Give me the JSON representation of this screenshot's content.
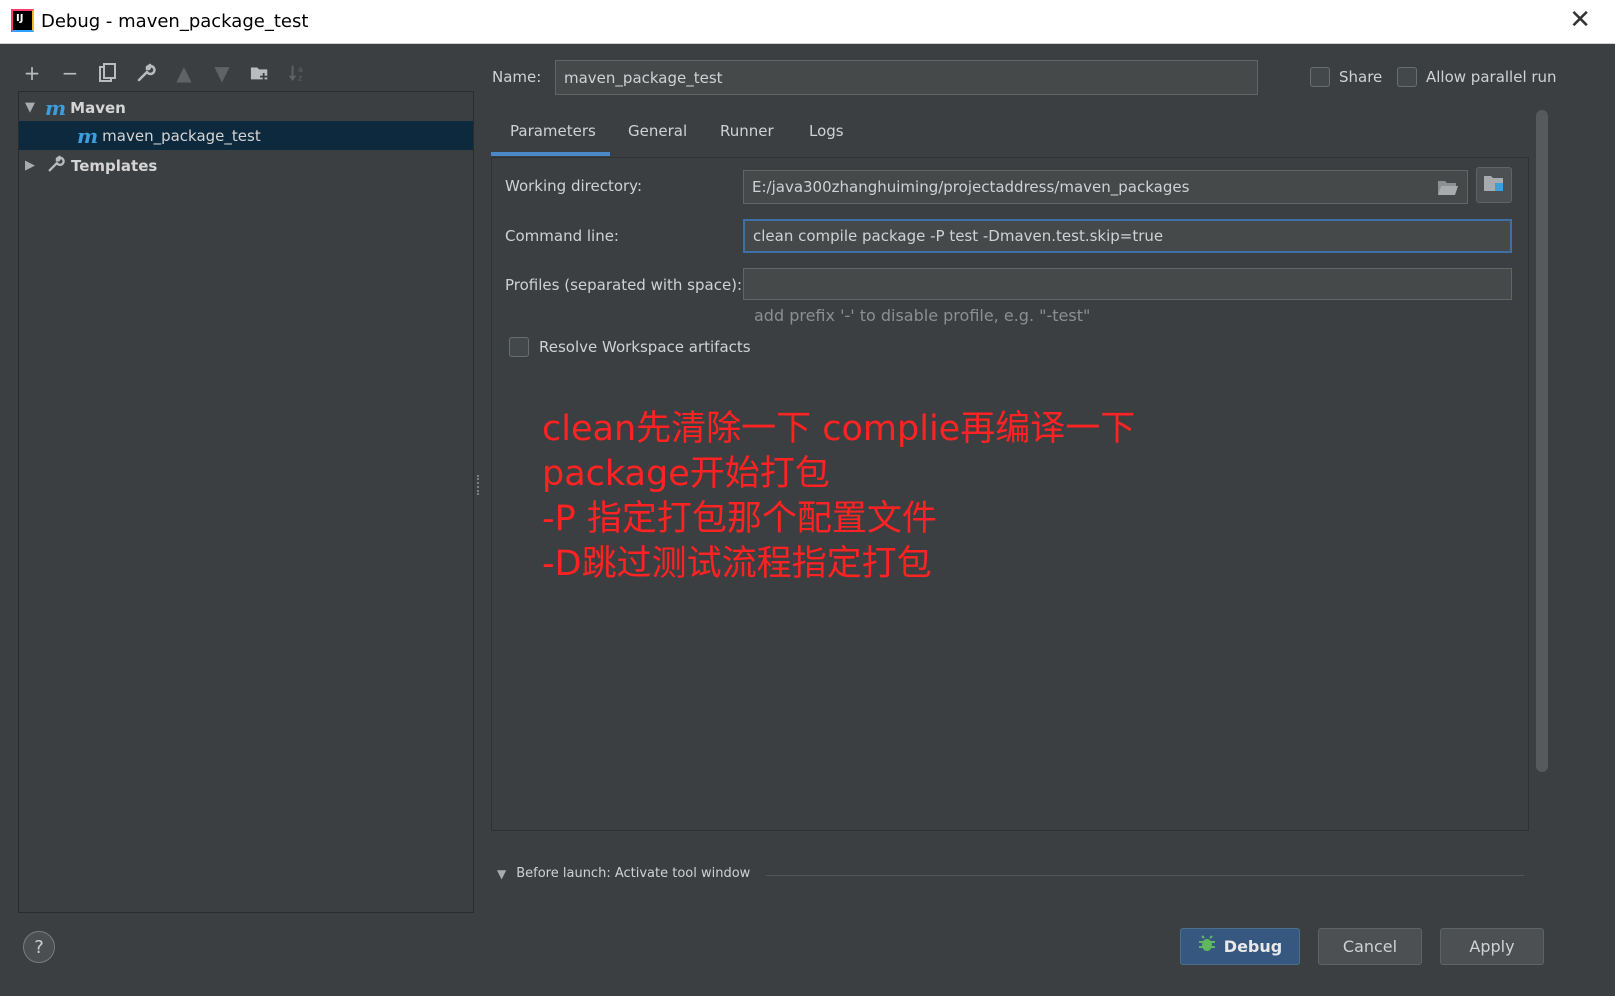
{
  "window": {
    "title": "Debug - maven_package_test",
    "app_icon": "IJ"
  },
  "toolbar": {
    "items": [
      "add-icon",
      "remove-icon",
      "copy-icon",
      "wrench-icon",
      "move-up-icon",
      "move-down-icon",
      "new-folder-icon",
      "sort-icon"
    ]
  },
  "tree": {
    "maven_label": "Maven",
    "maven_child": "maven_package_test",
    "templates_label": "Templates"
  },
  "form": {
    "name_label": "Name:",
    "name_value": "maven_package_test",
    "share_label": "Share",
    "parallel_label": "Allow parallel run"
  },
  "tabs": [
    "Parameters",
    "General",
    "Runner",
    "Logs"
  ],
  "parameters": {
    "workdir_label": "Working directory:",
    "workdir_value": "E:/java300zhanghuiming/projectaddress/maven_packages",
    "cmd_label": "Command line:",
    "cmd_value": "clean  compile  package -P test -Dmaven.test.skip=true",
    "profiles_label": "Profiles (separated with space):",
    "profiles_value": "",
    "profiles_hint": "add prefix '-' to disable profile, e.g. \"-test\"",
    "resolve_label": "Resolve Workspace artifacts"
  },
  "annotation": [
    "clean先清除一下 complie再编译一下",
    "package开始打包",
    "-P 指定打包那个配置文件",
    "-D跳过测试流程指定打包"
  ],
  "before_launch": "Before launch: Activate tool window",
  "buttons": {
    "debug": "Debug",
    "cancel": "Cancel",
    "apply": "Apply",
    "help": "?"
  },
  "colors": {
    "background": "#3c3f41",
    "selection": "#0d293e",
    "accent": "#4a88c7",
    "annotation": "#ff2222"
  }
}
